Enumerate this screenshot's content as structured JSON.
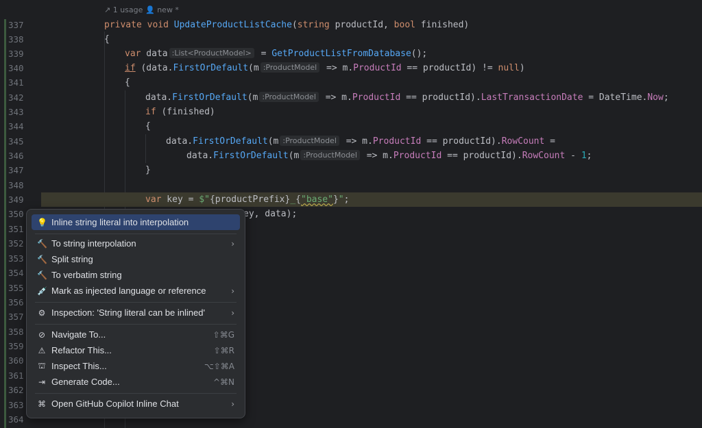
{
  "header": {
    "usages": "1 usage",
    "author": "new *"
  },
  "lines": [
    {
      "n": "337"
    },
    {
      "n": "338"
    },
    {
      "n": "339"
    },
    {
      "n": "340"
    },
    {
      "n": "341"
    },
    {
      "n": "342"
    },
    {
      "n": "343"
    },
    {
      "n": "344"
    },
    {
      "n": "345"
    },
    {
      "n": "346"
    },
    {
      "n": "347"
    },
    {
      "n": "348"
    },
    {
      "n": "349"
    },
    {
      "n": "350"
    },
    {
      "n": "351"
    },
    {
      "n": "352"
    },
    {
      "n": "353"
    },
    {
      "n": "354"
    },
    {
      "n": "355"
    },
    {
      "n": "356"
    },
    {
      "n": "357"
    },
    {
      "n": "358"
    },
    {
      "n": "359"
    },
    {
      "n": "360"
    },
    {
      "n": "361"
    },
    {
      "n": "362"
    },
    {
      "n": "363"
    },
    {
      "n": "364"
    }
  ],
  "code": {
    "l337": {
      "a": "private",
      "b": "void",
      "fn": "UpdateProductListCache",
      "c": "(",
      "t1": "string",
      "d": " productId, ",
      "t2": "bool",
      "e": " finished)"
    },
    "l338": "{",
    "l339": {
      "kw": "var",
      "v": " data",
      "hint": ":List<ProductModel>",
      "rest": " = ",
      "fn": "GetProductListFromDatabase",
      "end": "();"
    },
    "l340": {
      "kw": "if",
      "a": " (data.",
      "fn": "FirstOrDefault",
      "b": "(m",
      "hint": ":ProductModel",
      "c": " => m.",
      "prop": "ProductId",
      "d": " == productId) != ",
      "nul": "null",
      ")": ")"
    },
    "l341": "{",
    "l342": {
      "a": "data.",
      "fn": "FirstOrDefault",
      "b": "(m",
      "hint": ":ProductModel",
      "c": " => m.",
      "prop": "ProductId",
      "d": " == productId).",
      "prop2": "LastTransactionDate",
      "e": " = ",
      "typ": "DateTime",
      "f": ".",
      "prop3": "Now",
      ";": ";"
    },
    "l343": {
      "kw": "if",
      "a": " (finished)"
    },
    "l344": "{",
    "l345": {
      "a": "data.",
      "fn": "FirstOrDefault",
      "b": "(m",
      "hint": ":ProductModel",
      "c": " => m.",
      "prop": "ProductId",
      "d": " == productId).",
      "prop2": "RowCount",
      "e": " ="
    },
    "l346": {
      "a": "data.",
      "fn": "FirstOrDefault",
      "b": "(m",
      "hint": ":ProductModel",
      "c": " => m.",
      "prop": "ProductId",
      "d": " == productId).",
      "prop2": "RowCount",
      "e": " - ",
      "num": "1",
      ";": ";"
    },
    "l347": "}",
    "l349": {
      "kw": "var",
      "a": " key = ",
      "s1": "$\"",
      "b": "{productPrefix}",
      "s2": "_",
      "c": "{",
      "s3": "\"base\"",
      "d": "}",
      "s4": "\"",
      ";": ";"
    },
    "l350": "ey, data);"
  },
  "menu": {
    "items": [
      {
        "icon": "💡",
        "label": "Inline string literal into interpolation",
        "shortcut": "",
        "arrow": ""
      },
      {
        "icon": "🔨",
        "label": "To string interpolation",
        "shortcut": "",
        "arrow": "›"
      },
      {
        "icon": "🔨",
        "label": "Split string",
        "shortcut": "",
        "arrow": ""
      },
      {
        "icon": "🔨",
        "label": "To verbatim string",
        "shortcut": "",
        "arrow": ""
      },
      {
        "icon": "💉",
        "label": "Mark as injected language or reference",
        "shortcut": "",
        "arrow": "›"
      },
      {
        "icon": "⚙",
        "label": "Inspection: 'String literal can be inlined'",
        "shortcut": "",
        "arrow": "›"
      },
      {
        "icon": "⊘",
        "label": "Navigate To...",
        "shortcut": "⇧⌘G",
        "arrow": ""
      },
      {
        "icon": "⚠",
        "label": "Refactor This...",
        "shortcut": "⇧⌘R",
        "arrow": ""
      },
      {
        "icon": "⛫",
        "label": "Inspect This...",
        "shortcut": "⌥⇧⌘A",
        "arrow": ""
      },
      {
        "icon": "⇥",
        "label": "Generate Code...",
        "shortcut": "^⌘N",
        "arrow": ""
      },
      {
        "icon": "⌘",
        "label": "Open GitHub Copilot Inline Chat",
        "shortcut": "",
        "arrow": "›"
      }
    ]
  },
  "colors": {
    "background": "#1e1f22",
    "selection": "#2e436e",
    "keyword": "#cf8e6d",
    "function": "#56a8f5",
    "property": "#c77dbb",
    "string": "#6aab73"
  }
}
